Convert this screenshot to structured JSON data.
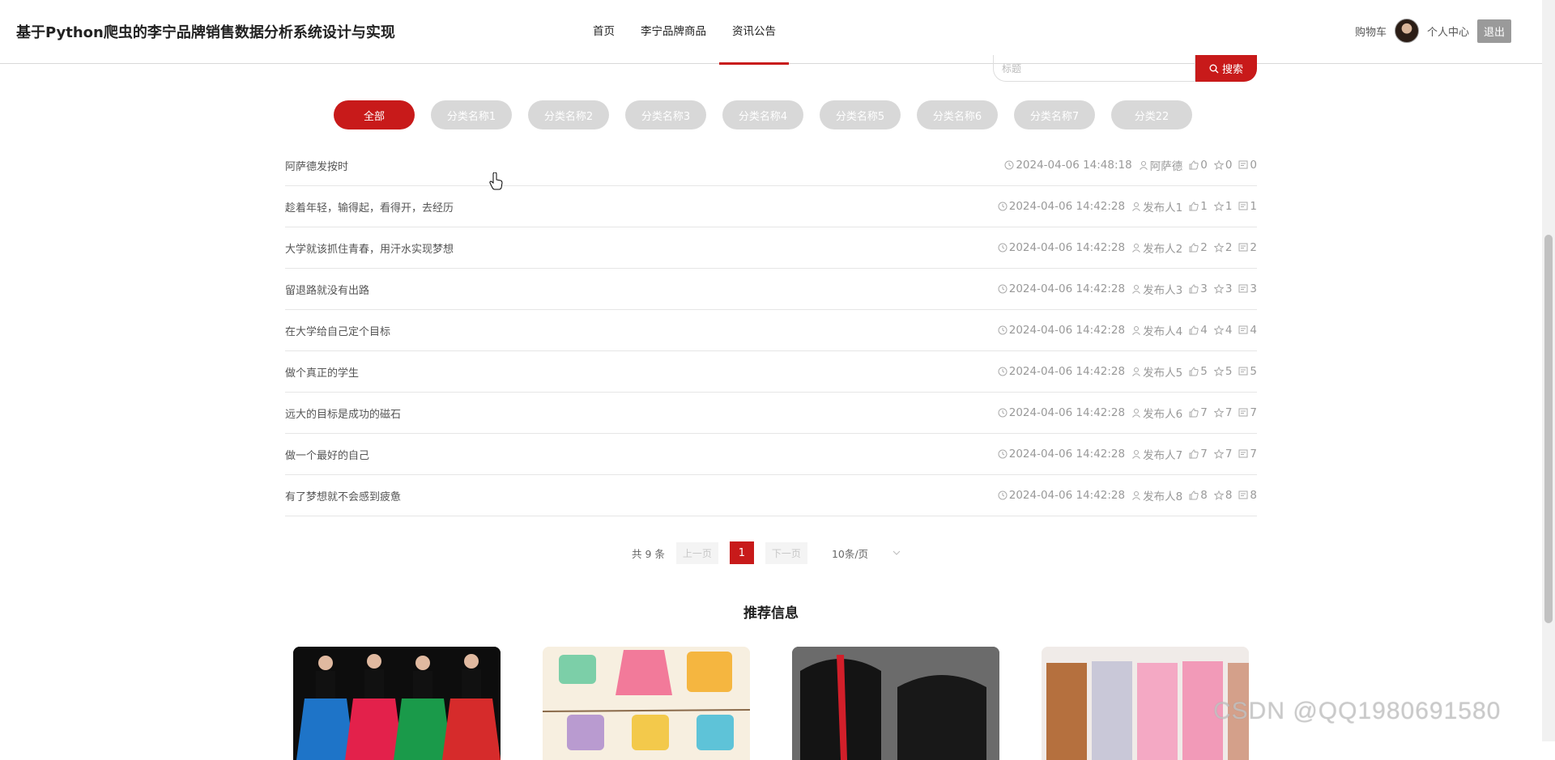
{
  "header": {
    "site_title": "基于Python爬虫的李宁品牌销售数据分析系统设计与实现",
    "nav": [
      {
        "label": "首页",
        "active": false
      },
      {
        "label": "李宁品牌商品",
        "active": false
      },
      {
        "label": "资讯公告",
        "active": true
      }
    ],
    "cart": "购物车",
    "personal_center": "个人中心",
    "logout": "退出"
  },
  "search": {
    "placeholder": "标题",
    "button": "搜索"
  },
  "categories": [
    "全部",
    "分类名称1",
    "分类名称2",
    "分类名称3",
    "分类名称4",
    "分类名称5",
    "分类名称6",
    "分类名称7",
    "分类22"
  ],
  "articles": [
    {
      "title": "阿萨德发按时",
      "time": "2024-04-06 14:48:18",
      "author": "阿萨德",
      "likes": "0",
      "favorites": "0",
      "comments": "0"
    },
    {
      "title": "趁着年轻，输得起，看得开，去经历",
      "time": "2024-04-06 14:42:28",
      "author": "发布人1",
      "likes": "1",
      "favorites": "1",
      "comments": "1"
    },
    {
      "title": "大学就该抓住青春，用汗水实现梦想",
      "time": "2024-04-06 14:42:28",
      "author": "发布人2",
      "likes": "2",
      "favorites": "2",
      "comments": "2"
    },
    {
      "title": "留退路就没有出路",
      "time": "2024-04-06 14:42:28",
      "author": "发布人3",
      "likes": "3",
      "favorites": "3",
      "comments": "3"
    },
    {
      "title": "在大学给自己定个目标",
      "time": "2024-04-06 14:42:28",
      "author": "发布人4",
      "likes": "4",
      "favorites": "4",
      "comments": "4"
    },
    {
      "title": "做个真正的学生",
      "time": "2024-04-06 14:42:28",
      "author": "发布人5",
      "likes": "5",
      "favorites": "5",
      "comments": "5"
    },
    {
      "title": "远大的目标是成功的磁石",
      "time": "2024-04-06 14:42:28",
      "author": "发布人6",
      "likes": "7",
      "favorites": "7",
      "comments": "7"
    },
    {
      "title": "做一个最好的自己",
      "time": "2024-04-06 14:42:28",
      "author": "发布人7",
      "likes": "7",
      "favorites": "7",
      "comments": "7"
    },
    {
      "title": "有了梦想就不会感到疲惫",
      "time": "2024-04-06 14:42:28",
      "author": "发布人8",
      "likes": "8",
      "favorites": "8",
      "comments": "8"
    }
  ],
  "pagination": {
    "total": "共 9 条",
    "prev": "上一页",
    "current": "1",
    "next": "下一页",
    "page_size": "10条/页"
  },
  "recommend": {
    "title": "推荐信息"
  },
  "watermark": "CSDN @QQ1980691580",
  "colors": {
    "accent": "#c81a1a",
    "category_inactive": "#d8d8d8"
  }
}
